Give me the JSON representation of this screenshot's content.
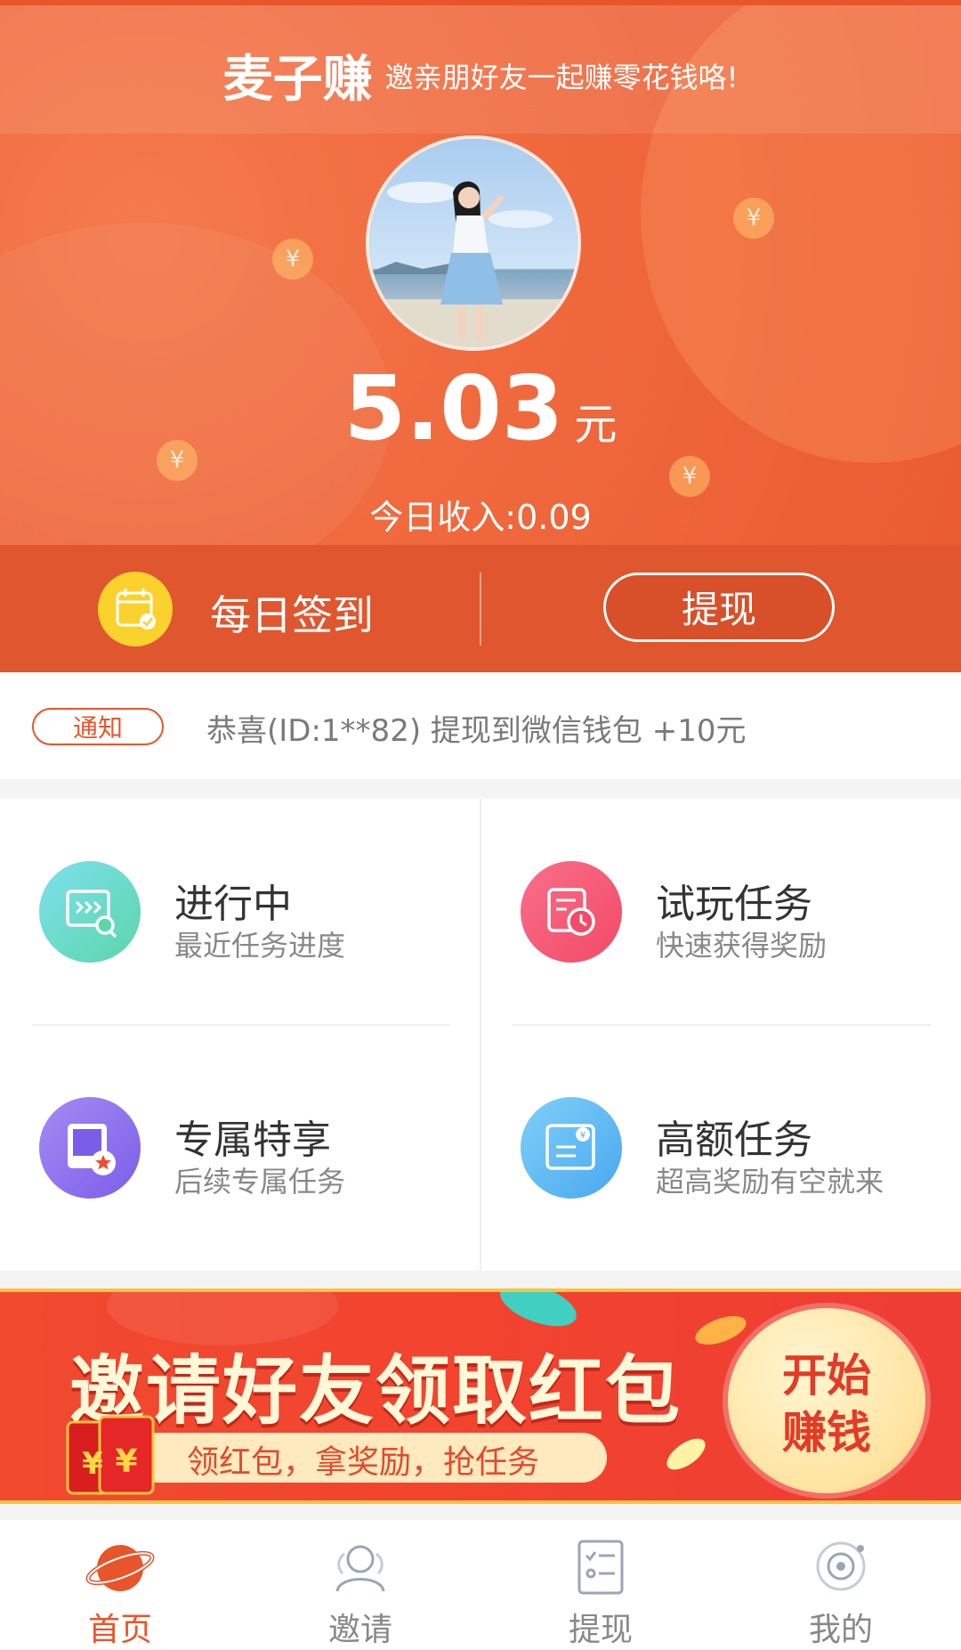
{
  "header": {
    "brand_name": "麦子赚",
    "slogan": "邀亲朋好友一起赚零花钱咯!",
    "balance": "5.03",
    "balance_unit": "元",
    "today_income": "今日收入:0.09",
    "checkin_label": "每日签到",
    "withdraw_label": "提现"
  },
  "notice": {
    "badge": "通知",
    "text": "恭喜(ID:1**82) 提现到微信钱包 +10元"
  },
  "grid": [
    {
      "title": "进行中",
      "subtitle": "最近任务进度",
      "icon": "task-progress-icon"
    },
    {
      "title": "试玩任务",
      "subtitle": "快速获得奖励",
      "icon": "trial-clock-icon"
    },
    {
      "title": "专属特享",
      "subtitle": "后续专属任务",
      "icon": "exclusive-star-icon"
    },
    {
      "title": "高额任务",
      "subtitle": "超高奖励有空就来",
      "icon": "money-card-icon"
    }
  ],
  "banner": {
    "title": "邀请好友领取红包",
    "subtitle": "领红包，拿奖励，抢任务",
    "cta_line1": "开始",
    "cta_line2": "赚钱"
  },
  "tabbar": {
    "active": 0,
    "active_color": "#e8552b",
    "inactive_color": "#888888",
    "items": [
      {
        "label": "首页",
        "icon": "home-planet-icon"
      },
      {
        "label": "邀请",
        "icon": "invite-people-icon"
      },
      {
        "label": "提现",
        "icon": "withdraw-list-icon"
      },
      {
        "label": "我的",
        "icon": "profile-galaxy-icon"
      }
    ]
  }
}
